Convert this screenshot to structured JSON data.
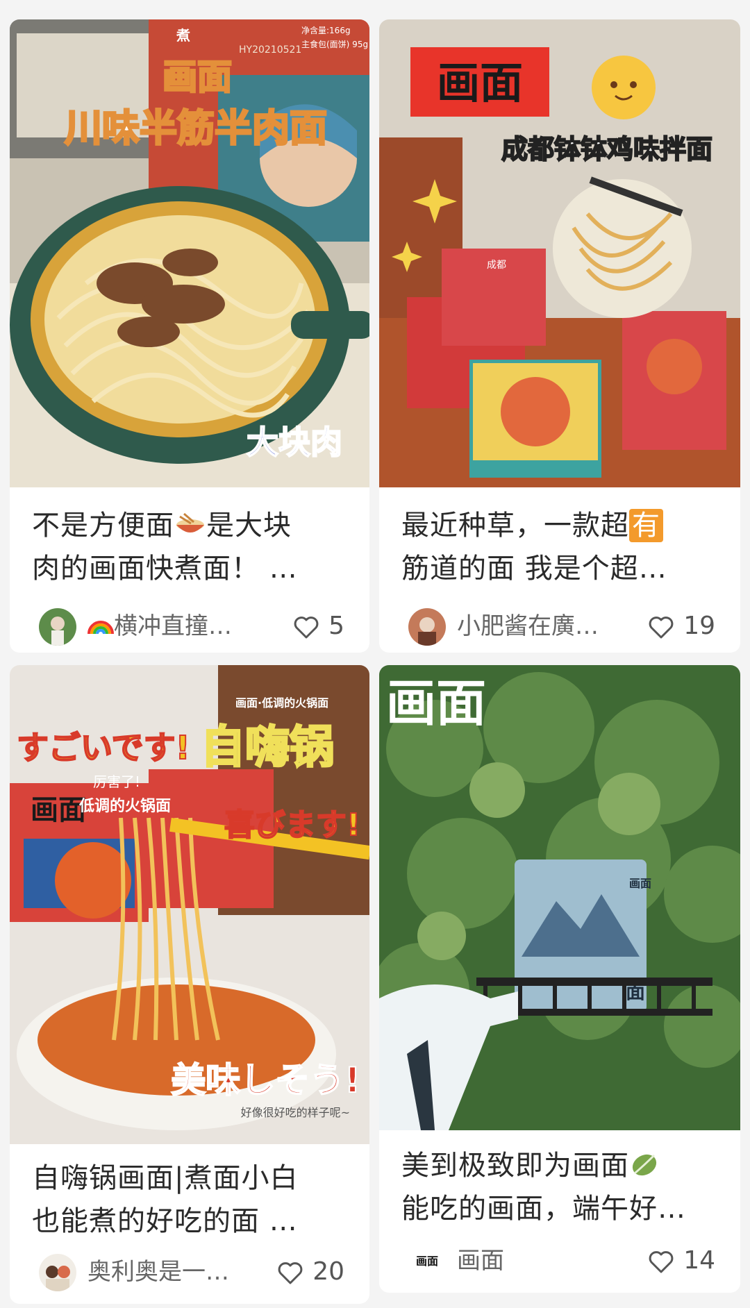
{
  "cards": [
    {
      "image_texts": [
        "画面",
        "川味半筋半肉面",
        "大块肉",
        "煮",
        "净含量:166g",
        "主食包(面饼) 95g",
        "HY20210521"
      ],
      "title_line1": "不是方便面",
      "title_line1b": "是大块",
      "title_line2": "肉的画面快煮面！ …",
      "author": "横冲直撞…",
      "likes": "5",
      "emoji": "noodle-bowl-icon"
    },
    {
      "image_texts": [
        "画面",
        "成都钵钵鸡味拌面",
        "成都"
      ],
      "title_line1": "最近种草，一款超",
      "title_line1b": "有",
      "title_line2": "筋道的面 我是个超…",
      "author": "小肥酱在廣…",
      "likes": "19"
    },
    {
      "image_texts": [
        "画面·低调的火锅面",
        "すごいです!",
        "厉害了!",
        "自嗨锅",
        "画面",
        "低调的火锅面",
        "喜びます!",
        "美味しそう!",
        "好像很好吃的样子呢~"
      ],
      "title_line1": "自嗨锅画面|煮面小白",
      "title_line2": "也能煮的好吃的面 …",
      "author": "奥利奥是一…",
      "likes": "20"
    },
    {
      "image_texts": [
        "画面",
        "画面",
        "面"
      ],
      "title_line1": "美到极致即为画面",
      "title_line2": "能吃的画面，端午好…",
      "author": "画面",
      "avatar_text": "画面",
      "likes": "14",
      "emoji": "leaf-icon"
    }
  ],
  "colors": {
    "background": "#f4f4f4",
    "card": "#ffffff",
    "brand_red": "#e23a2e",
    "text": "#2a2a2a",
    "meta": "#666666"
  }
}
